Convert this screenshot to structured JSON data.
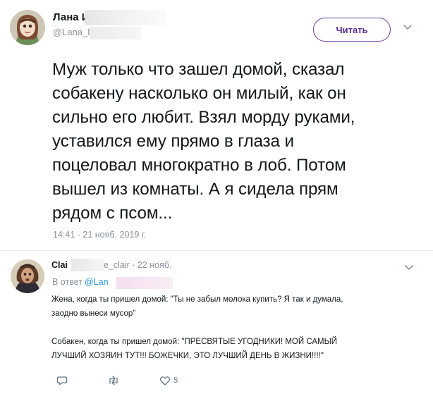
{
  "main_tweet": {
    "author_name": "Лана И",
    "author_handle": "@Lana_lpe",
    "follow_label": "Читать",
    "text_lines": [
      "Муж только что зашел домой, сказал",
      "собакену насколько он милый, как он",
      "сильно его любит. Взял морду руками,",
      "уставился ему прямо в глаза и",
      "поцеловал многократно в лоб. Потом",
      "вышел из комнаты. А я сидела прям",
      "рядом с псом..."
    ],
    "timestamp": "14:41 - 21 нояб. 2019 г."
  },
  "reply": {
    "author_name": "Clai",
    "author_handle": "ge_clair",
    "date": "· 22 нояб.",
    "reply_to_prefix": "В ответ",
    "reply_to_mention": "@Lan",
    "paragraphs": [
      [
        "Жена, когда ты пришел домой: \"Ты не забыл молока купить? Я так и думала,",
        "заодно вынеси мусор\""
      ],
      [
        "Собакен, когда ты пришел домой: \"ПРЕСВЯТЫЕ УГОДНИКИ! МОЙ САМЫЙ",
        "ЛУЧШИЙ ХОЗЯИН ТУТ!!! БОЖЕЧКИ, ЭТО ЛУЧШИЙ ДЕНЬ В ЖИЗНИ!!!!\""
      ]
    ],
    "like_count": "5"
  },
  "icons": {
    "reply": "speech-bubble-icon",
    "retweet": "retweet-icon",
    "like": "heart-icon",
    "menu": "chevron-down-icon"
  },
  "colors": {
    "accent_purple": "#6c3aa6",
    "link_blue": "#1b95e0",
    "meta_gray": "#8a9199"
  }
}
